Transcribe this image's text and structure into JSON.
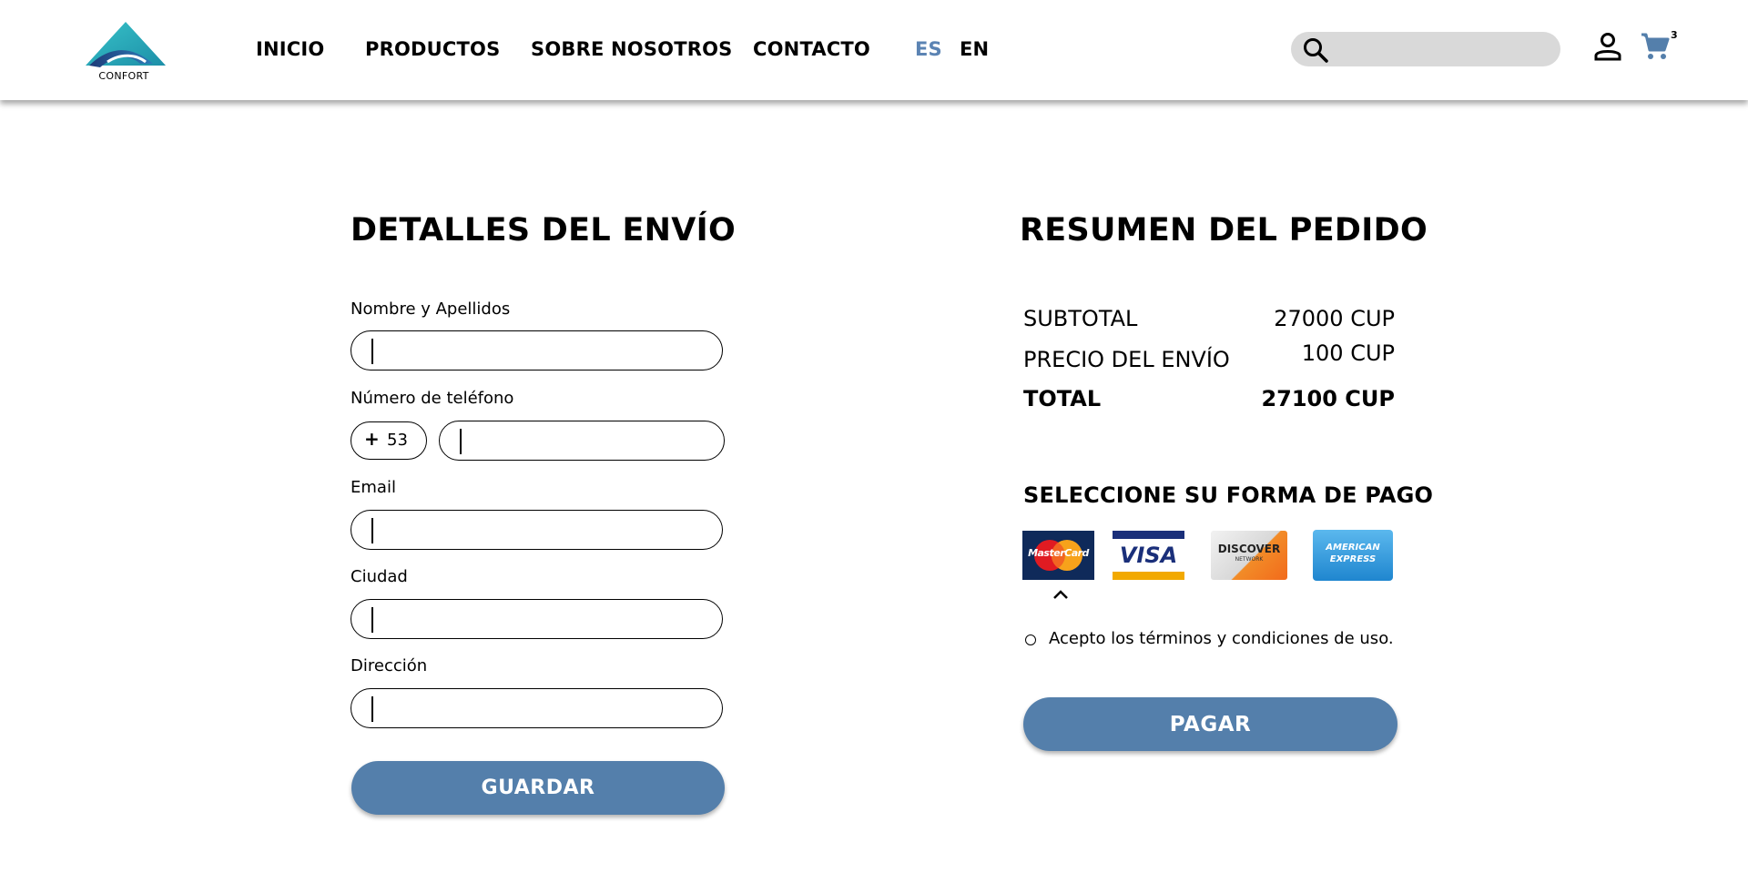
{
  "header": {
    "logo_text": "CONFORT",
    "nav": [
      {
        "label": "INICIO"
      },
      {
        "label": "PRODUCTOS"
      },
      {
        "label": "SOBRE NOSOTROS"
      },
      {
        "label": "CONTACTO"
      }
    ],
    "languages": {
      "es": "ES",
      "en": "EN",
      "active": "ES"
    },
    "search": {
      "placeholder": ""
    },
    "icons": {
      "search": "search-icon",
      "user": "user-icon",
      "cart": "cart-icon"
    },
    "cart_count": "3"
  },
  "shipping": {
    "title": "DETALLES DEL ENVÍO",
    "fields": {
      "name": {
        "label": "Nombre y Apellidos",
        "value": ""
      },
      "phone": {
        "label": "Número de teléfono",
        "prefix_symbol": "+",
        "prefix_code": "53",
        "value": ""
      },
      "email": {
        "label": "Email",
        "value": ""
      },
      "city": {
        "label": "Ciudad",
        "value": ""
      },
      "address": {
        "label": "Dirección",
        "value": ""
      }
    },
    "save_label": "GUARDAR"
  },
  "summary": {
    "title": "RESUMEN DEL PEDIDO",
    "subtotal_label": "SUBTOTAL",
    "subtotal_value": "27000 CUP",
    "shipping_label": "PRECIO DEL ENVÍO",
    "shipping_value": "100 CUP",
    "total_label": "TOTAL",
    "total_value": "27100 CUP",
    "payment_title": "SELECCIONE SU FORMA DE PAGO",
    "cards": {
      "mastercard": "MasterCard",
      "visa": "VISA",
      "discover_main": "DISCOVER",
      "discover_sub": "NETWORK",
      "amex_line1": "AMERICAN",
      "amex_line2": "EXPRESS"
    },
    "selected_card": "MasterCard",
    "terms_label": "Acepto los términos y condiciones de uso.",
    "pay_label": "PAGAR"
  },
  "colors": {
    "accent": "#547fab",
    "lang_active": "#5b83b3",
    "search_bg": "#d9d9d9",
    "logo_teal": "#2aa8b8",
    "logo_navy": "#1d3f7a"
  }
}
